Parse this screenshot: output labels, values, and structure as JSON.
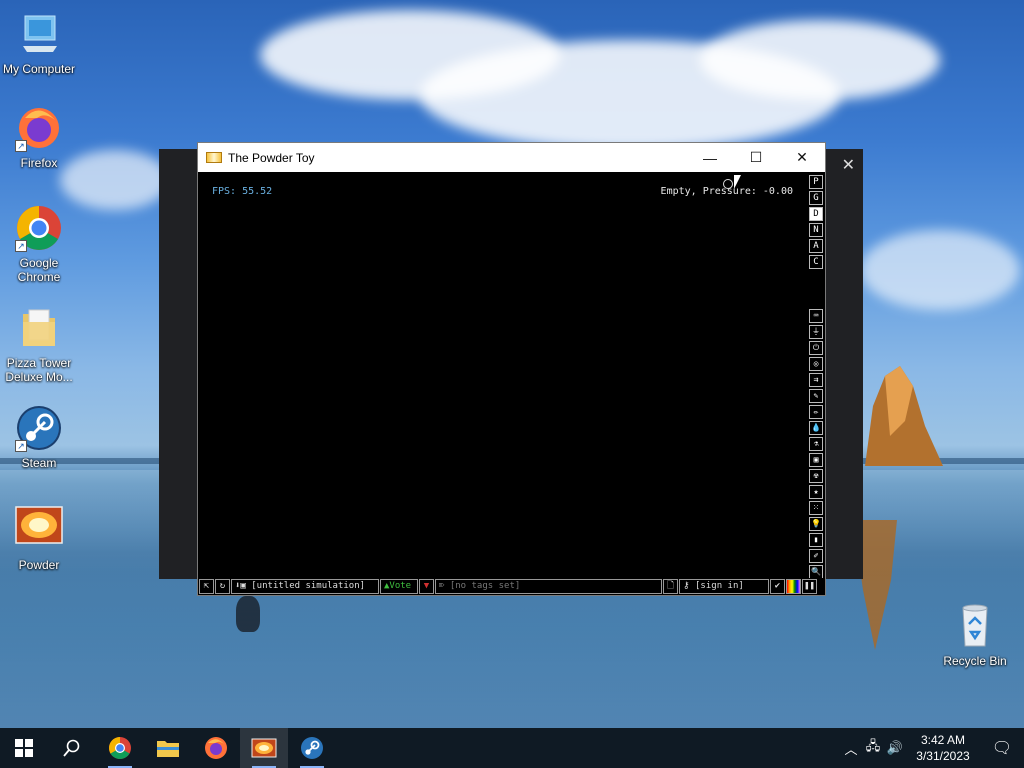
{
  "desktop": {
    "icons": [
      {
        "label": "My Computer",
        "icon": "my-computer-icon"
      },
      {
        "label": "Firefox",
        "icon": "firefox-icon"
      },
      {
        "label": "Google Chrome",
        "icon": "chrome-icon"
      },
      {
        "label": "Pizza Tower Deluxe Mo...",
        "icon": "folder-icon"
      },
      {
        "label": "Steam",
        "icon": "steam-icon"
      },
      {
        "label": "Powder",
        "icon": "powder-icon"
      }
    ],
    "recycle_bin": {
      "label": "Recycle Bin",
      "icon": "recycle-bin-icon"
    }
  },
  "backdrop": {
    "close_glyph": "✕"
  },
  "window": {
    "title": "The Powder Toy",
    "minimize_glyph": "—",
    "maximize_glyph": "☐",
    "close_glyph": "✕"
  },
  "game": {
    "fps_text": "FPS: 55.52",
    "status_text": "Empty, Pressure: -0.00",
    "render_modes": [
      "P",
      "G",
      "D",
      "N",
      "A",
      "C"
    ],
    "active_render_mode": "D",
    "tool_categories": [
      "⌨",
      "⏚",
      "⏻",
      "◎",
      "⇉",
      "✎",
      "✏",
      "💧",
      "⚗",
      "▣",
      "☢",
      "★",
      "⁙",
      "💡",
      "▮",
      "✐",
      "🔍"
    ],
    "bottom_bar": {
      "open_icon": "⇱",
      "reload_icon": "↻",
      "save_label": "[untitled simulation]",
      "vote_label": "Vote",
      "tags_label": "[no tags set]",
      "sign_in_label": "[sign in]"
    }
  },
  "taskbar": {
    "apps": [
      "start-icon",
      "search-icon",
      "chrome-icon",
      "file-explorer-icon",
      "firefox-icon",
      "powder-icon",
      "steam-icon"
    ],
    "time": "3:42 AM",
    "date": "3/31/2023"
  }
}
